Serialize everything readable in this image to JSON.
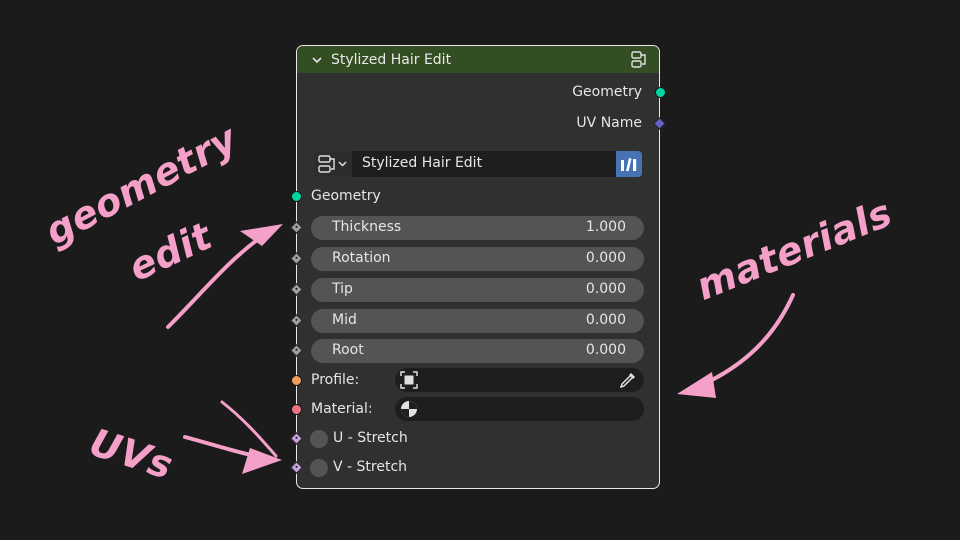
{
  "node": {
    "title": "Stylized Hair Edit",
    "outputs": [
      {
        "label": "Geometry",
        "socket_color": "#00d6a3",
        "socket_shape": "circle"
      },
      {
        "label": "UV Name",
        "socket_color": "#6363c7",
        "socket_shape": "diamond"
      }
    ],
    "group_selector": {
      "name": "Stylized Hair Edit",
      "browse_icon": "node-tree-icon",
      "fake_user_icon": "fake-user-icon"
    },
    "geometry_input": {
      "label": "Geometry",
      "socket_color": "#00d6a3"
    },
    "fields": [
      {
        "label": "Thickness",
        "value": "1.000"
      },
      {
        "label": "Rotation",
        "value": "0.000"
      },
      {
        "label": "Tip",
        "value": "0.000"
      },
      {
        "label": "Mid",
        "value": "0.000"
      },
      {
        "label": "Root",
        "value": "0.000"
      }
    ],
    "profile": {
      "label": "Profile:",
      "icon": "object-icon",
      "picker_icon": "eyedropper-icon",
      "socket_color": "#ed9e5c"
    },
    "material": {
      "label": "Material:",
      "icon": "material-icon",
      "socket_color": "#eb7582"
    },
    "toggles": [
      {
        "label": "U - Stretch",
        "checked": false
      },
      {
        "label": "V - Stretch",
        "checked": false
      }
    ],
    "colors": {
      "header": "#344e24",
      "body": "#303030",
      "field": "#545454",
      "fake_user_accent": "#4772b3"
    }
  },
  "annotations": {
    "geometry": "geometry",
    "edit": "edit",
    "materials": "materials",
    "uvs": "UVs",
    "color": "#f5a0c8"
  }
}
